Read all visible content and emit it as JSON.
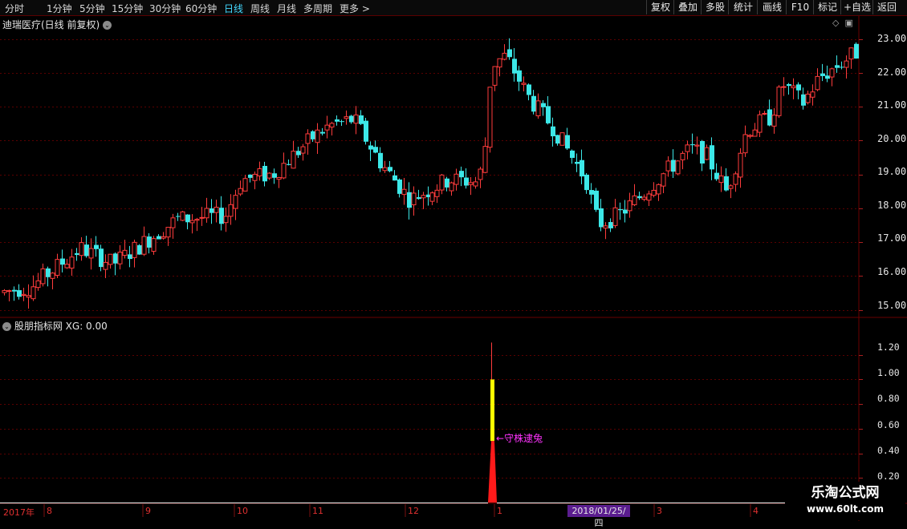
{
  "toolbar": {
    "timeframes": [
      "分时",
      "1分钟",
      "5分钟",
      "15分钟",
      "30分钟",
      "60分钟",
      "日线",
      "周线",
      "月线",
      "多周期",
      "更多"
    ],
    "active_timeframe": "日线",
    "more_arrow": ">",
    "buttons": [
      "复权",
      "叠加",
      "多股",
      "统计",
      "画线",
      "F10",
      "标记",
      "+自选",
      "返回"
    ]
  },
  "main_chart": {
    "title": "迪瑞医疗(日线 前复权)",
    "y_labels": [
      "23.00",
      "22.00",
      "21.00",
      "20.00",
      "19.00",
      "18.00",
      "17.00",
      "16.00",
      "15.00"
    ]
  },
  "indicator": {
    "title": "股朋指标网",
    "value_text": "XG: 0.00",
    "y_labels": [
      "1.20",
      "1.00",
      "0.80",
      "0.60",
      "0.40",
      "0.20"
    ],
    "annotation": "守株逮兔"
  },
  "x_axis": {
    "labels": [
      "2017年",
      "8",
      "9",
      "10",
      "11",
      "12",
      "1",
      "3",
      "4"
    ],
    "cursor_date": "2018/01/25/四"
  },
  "watermark": {
    "line1": "乐淘公式网",
    "line2": "www.60lt.com"
  },
  "colors": {
    "up": "#ff3c3c",
    "down": "#3ce8e8",
    "active_tab": "#43d8ff",
    "signal_yellow": "#ffff00",
    "annotation": "#ff33ff"
  },
  "chart_data": {
    "type": "candlestick",
    "ylim": [
      14.8,
      23.3
    ],
    "signal": {
      "type": "bar",
      "category": "2018/01/25",
      "values": [
        0.5,
        1.0,
        1.3
      ],
      "ylim": [
        0,
        1.4
      ]
    },
    "anchors": [
      {
        "m": "2017-07",
        "price": 15.6
      },
      {
        "m": "2017-08",
        "price": 16.5
      },
      {
        "m": "2017-09",
        "price": 17.6
      },
      {
        "m": "2017-10",
        "price": 19.0
      },
      {
        "m": "2017-11",
        "price": 20.5
      },
      {
        "m": "2017-12",
        "price": 18.5
      },
      {
        "m": "2018-01",
        "price": 22.3
      },
      {
        "m": "2018-02",
        "price": 17.5
      },
      {
        "m": "2018-03",
        "price": 19.5
      },
      {
        "m": "2018-04",
        "price": 22.6
      }
    ]
  }
}
